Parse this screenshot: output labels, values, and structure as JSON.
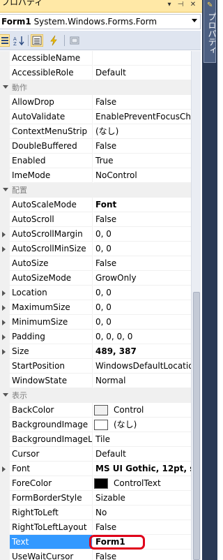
{
  "window": {
    "title": "プロパティ",
    "colors": {
      "titlebar": "#ffe8a6",
      "side_tab": "#293955"
    }
  },
  "object_selector": {
    "name": "Form1",
    "type": "System.Windows.Forms.Form"
  },
  "toolbar": {
    "icons": [
      "categorized-icon",
      "alphabetical-icon",
      "properties-icon",
      "events-icon",
      "property-pages-icon"
    ]
  },
  "side_tab": {
    "label": "プロパティ"
  },
  "grid": {
    "rows": [
      {
        "kind": "prop",
        "name": "AccessibleName",
        "value": ""
      },
      {
        "kind": "prop",
        "name": "AccessibleRole",
        "value": "Default"
      },
      {
        "kind": "category",
        "name": "動作"
      },
      {
        "kind": "prop",
        "name": "AllowDrop",
        "value": "False"
      },
      {
        "kind": "prop",
        "name": "AutoValidate",
        "value": "EnablePreventFocusCha"
      },
      {
        "kind": "prop",
        "name": "ContextMenuStrip",
        "value": "(なし)"
      },
      {
        "kind": "prop",
        "name": "DoubleBuffered",
        "value": "False"
      },
      {
        "kind": "prop",
        "name": "Enabled",
        "value": "True"
      },
      {
        "kind": "prop",
        "name": "ImeMode",
        "value": "NoControl"
      },
      {
        "kind": "category",
        "name": "配置"
      },
      {
        "kind": "prop",
        "name": "AutoScaleMode",
        "value": "Font",
        "bold": true
      },
      {
        "kind": "prop",
        "name": "AutoScroll",
        "value": "False"
      },
      {
        "kind": "prop",
        "name": "AutoScrollMargin",
        "value": "0, 0",
        "expandable": true
      },
      {
        "kind": "prop",
        "name": "AutoScrollMinSize",
        "value": "0, 0",
        "expandable": true
      },
      {
        "kind": "prop",
        "name": "AutoSize",
        "value": "False"
      },
      {
        "kind": "prop",
        "name": "AutoSizeMode",
        "value": "GrowOnly"
      },
      {
        "kind": "prop",
        "name": "Location",
        "value": "0, 0",
        "expandable": true
      },
      {
        "kind": "prop",
        "name": "MaximumSize",
        "value": "0, 0",
        "expandable": true
      },
      {
        "kind": "prop",
        "name": "MinimumSize",
        "value": "0, 0",
        "expandable": true
      },
      {
        "kind": "prop",
        "name": "Padding",
        "value": "0, 0, 0, 0",
        "expandable": true
      },
      {
        "kind": "prop",
        "name": "Size",
        "value": "489, 387",
        "bold": true,
        "expandable": true
      },
      {
        "kind": "prop",
        "name": "StartPosition",
        "value": "WindowsDefaultLocatio"
      },
      {
        "kind": "prop",
        "name": "WindowState",
        "value": "Normal"
      },
      {
        "kind": "category",
        "name": "表示"
      },
      {
        "kind": "prop",
        "name": "BackColor",
        "value": "Control",
        "swatch": "#f0f0f0"
      },
      {
        "kind": "prop",
        "name": "BackgroundImage",
        "value": "(なし)",
        "swatch": "#ffffff"
      },
      {
        "kind": "prop",
        "name": "BackgroundImageLayout",
        "value": "Tile"
      },
      {
        "kind": "prop",
        "name": "Cursor",
        "value": "Default"
      },
      {
        "kind": "prop",
        "name": "Font",
        "value": "MS UI Gothic, 12pt, s",
        "bold": true,
        "expandable": true
      },
      {
        "kind": "prop",
        "name": "ForeColor",
        "value": "ControlText",
        "swatch": "#000000"
      },
      {
        "kind": "prop",
        "name": "FormBorderStyle",
        "value": "Sizable"
      },
      {
        "kind": "prop",
        "name": "RightToLeft",
        "value": "No"
      },
      {
        "kind": "prop",
        "name": "RightToLeftLayout",
        "value": "False"
      },
      {
        "kind": "prop",
        "name": "Text",
        "value": "Form1",
        "bold": true,
        "selected": true,
        "highlight": "#e0001a"
      },
      {
        "kind": "prop",
        "name": "UseWaitCursor",
        "value": "False"
      }
    ]
  },
  "colors": {
    "selected_row": "#3399ff",
    "category_bg": "#f0f0f0",
    "highlight_ring": "#e0001a"
  }
}
